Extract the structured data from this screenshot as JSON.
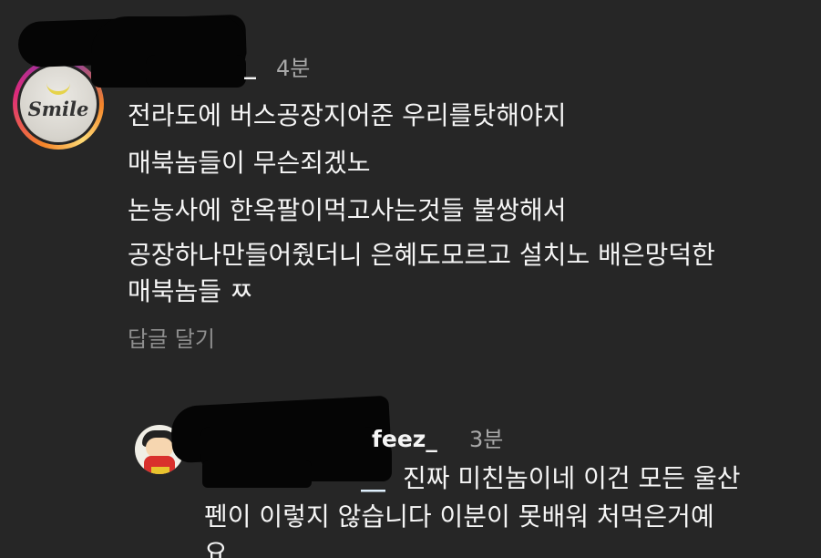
{
  "comment": {
    "username_visible": "_",
    "time": "4분",
    "lines": [
      "전라도에 버스공장지어준 우리를탓해야지",
      "매북놈들이 무슨죄겠노",
      "논농사에 한옥팔이먹고사는것들 불쌍해서",
      "공장하나만들어줬더니 은혜도모르고 설치노 배은망덕한",
      "매북놈들 ㅉ"
    ],
    "reply_label": "답글 달기",
    "avatar_text": "Smile"
  },
  "reply": {
    "username_visible": "feez_",
    "time": "3분",
    "mention_visible": "__",
    "lines": [
      "진짜 미친놈이네 이건 모든 울산",
      "펜이 이렇지 않습니다 이분이 못배워 처먹은거예",
      "요"
    ]
  },
  "colors": {
    "background": "#262626",
    "text_primary": "#f5f5f5",
    "text_secondary": "#a8a8a8",
    "reply_link": "#8e8e8e",
    "redaction": "#050505"
  }
}
